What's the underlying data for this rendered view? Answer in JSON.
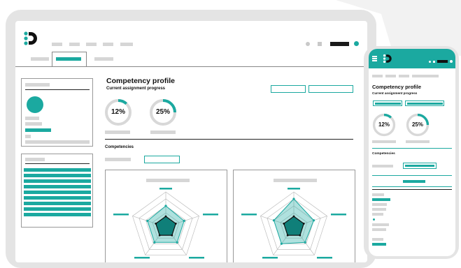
{
  "colors": {
    "accent": "#1ba9a0",
    "frame": "#e6e6e6",
    "dark": "#1a1a1a"
  },
  "icons": {
    "logo": "brand-logo-icon",
    "menu": "hamburger-menu-icon"
  },
  "desktop": {
    "title": "Competency profile",
    "subtitle": "Current assignment progress",
    "progress": [
      {
        "label": "12%",
        "value": 12
      },
      {
        "label": "25%",
        "value": 25
      }
    ],
    "section_label": "Competencies",
    "radar_a": {
      "levels": [
        0.6,
        0.55,
        0.55,
        0.55,
        0.55
      ]
    },
    "radar_b": {
      "levels": [
        0.8,
        0.6,
        0.55,
        0.6,
        0.6
      ]
    }
  },
  "mobile": {
    "title": "Competency profile",
    "subtitle": "Current assignment progress",
    "progress": [
      {
        "label": "12%",
        "value": 12
      },
      {
        "label": "25%",
        "value": 25
      }
    ],
    "section_label": "Competencies"
  }
}
